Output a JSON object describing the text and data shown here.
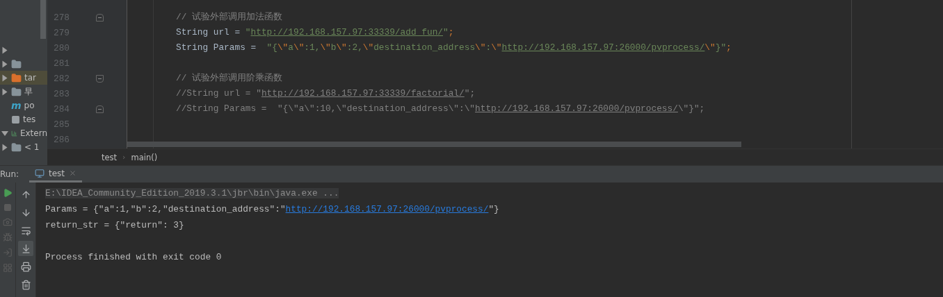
{
  "project_tree": [
    {
      "kind": "blank",
      "expanded": false,
      "selected": false
    },
    {
      "kind": "folder",
      "expanded": false,
      "selected": false
    },
    {
      "label": "tar",
      "kind": "orange-folder",
      "expanded": false,
      "selected": true
    },
    {
      "label": "早",
      "kind": "folder",
      "expanded": false,
      "selected": false
    },
    {
      "label": "po",
      "kind": "maven",
      "glyph": "m",
      "selected": false
    },
    {
      "label": "tes",
      "kind": "file",
      "selected": false
    },
    {
      "label": "Extern",
      "kind": "library",
      "expanded": true,
      "selected": false
    },
    {
      "label": "< 1",
      "kind": "folder",
      "expanded": false,
      "selected": false
    }
  ],
  "editor": {
    "lines": [
      {
        "number": "278",
        "fold_start": false,
        "segments": [
          {
            "kind": "comment",
            "text": "// 试验外部调用加法函数"
          }
        ]
      },
      {
        "number": "279",
        "segments": [
          {
            "kind": "plain",
            "text": "String url = "
          },
          {
            "kind": "string",
            "text": "\""
          },
          {
            "kind": "link",
            "text": "http://192.168.157.97:33339/add_fun/"
          },
          {
            "kind": "string",
            "text": "\""
          },
          {
            "kind": "keyword",
            "text": ";"
          }
        ]
      },
      {
        "number": "280",
        "segments": [
          {
            "kind": "plain",
            "text": "String Params =  "
          },
          {
            "kind": "string",
            "text": "\"{"
          },
          {
            "kind": "keyword",
            "text": "\\\""
          },
          {
            "kind": "string",
            "text": "a"
          },
          {
            "kind": "keyword",
            "text": "\\\""
          },
          {
            "kind": "string",
            "text": ":1,"
          },
          {
            "kind": "keyword",
            "text": "\\\""
          },
          {
            "kind": "string",
            "text": "b"
          },
          {
            "kind": "keyword",
            "text": "\\\""
          },
          {
            "kind": "string",
            "text": ":2,"
          },
          {
            "kind": "keyword",
            "text": "\\\""
          },
          {
            "kind": "string",
            "text": "destination_address"
          },
          {
            "kind": "keyword",
            "text": "\\\""
          },
          {
            "kind": "string",
            "text": ":"
          },
          {
            "kind": "keyword",
            "text": "\\\""
          },
          {
            "kind": "link",
            "text": "http://192.168.157.97:26000/pvprocess/"
          },
          {
            "kind": "keyword",
            "text": "\\\""
          },
          {
            "kind": "string",
            "text": "}\""
          },
          {
            "kind": "keyword",
            "text": ";"
          }
        ]
      },
      {
        "number": "281"
      },
      {
        "number": "282",
        "fold_start": true,
        "segments": [
          {
            "kind": "comment",
            "text": "// 试验外部调用阶乘函数"
          }
        ]
      },
      {
        "number": "283",
        "segments": [
          {
            "kind": "comment",
            "text": "//String url = \""
          },
          {
            "kind": "comment-link",
            "text": "http://192.168.157.97:33339/factorial/"
          },
          {
            "kind": "comment",
            "text": "\";"
          }
        ]
      },
      {
        "number": "284",
        "fold_start": false,
        "segments": [
          {
            "kind": "comment",
            "text": "//String Params =  \"{\\\"a\\\":10,\\\"destination_address\\\":\\\""
          },
          {
            "kind": "comment-link",
            "text": "http://192.168.157.97:26000/pvprocess/"
          },
          {
            "kind": "comment",
            "text": "\\\"}\";"
          }
        ]
      },
      {
        "number": "285"
      },
      {
        "number": "286"
      }
    ],
    "breadcrumbs": [
      {
        "label": "test"
      },
      {
        "separator": "›",
        "label": "main()"
      }
    ]
  },
  "run": {
    "label": "Run:",
    "tabs": [
      {
        "label": "test",
        "selected": true
      }
    ],
    "console": [
      {
        "kind": "command",
        "segments": [
          {
            "kind": "plain",
            "text": "E:\\IDEA_Community_Edition_2019.3.1\\jbr\\bin\\java.exe ..."
          }
        ]
      },
      {
        "kind": "output",
        "segments": [
          {
            "kind": "plain",
            "text": "Params = {\"a\":1,\"b\":2,\"destination_address\":\""
          },
          {
            "kind": "link",
            "text": "http://192.168.157.97:26000/pvprocess/"
          },
          {
            "kind": "plain",
            "text": "\"}"
          }
        ]
      },
      {
        "kind": "output",
        "segments": [
          {
            "kind": "plain",
            "text": "return_str = {\"return\": 3}"
          }
        ]
      },
      {
        "kind": "output"
      },
      {
        "kind": "output",
        "segments": [
          {
            "kind": "plain",
            "text": "Process finished with exit code 0"
          }
        ]
      }
    ]
  }
}
